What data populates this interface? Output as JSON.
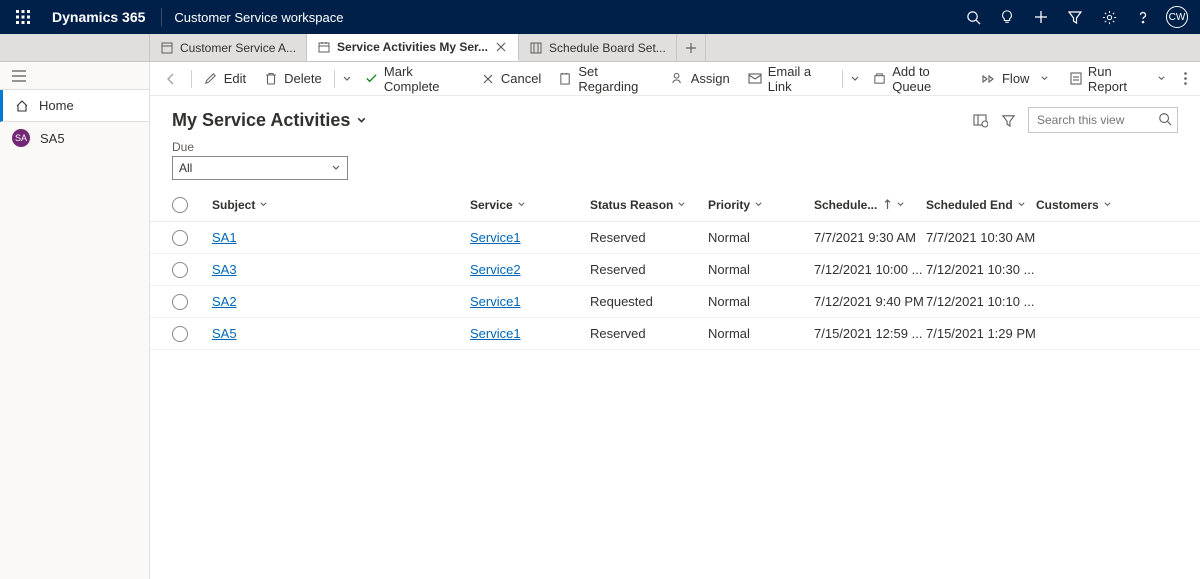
{
  "header": {
    "brand": "Dynamics 365",
    "app_name": "Customer Service workspace",
    "avatar_initials": "CW"
  },
  "tabs": [
    {
      "label": "Customer Service A..."
    },
    {
      "label": "Service Activities My Ser..."
    },
    {
      "label": "Schedule Board Set..."
    }
  ],
  "nav": {
    "home_label": "Home",
    "record_label": "SA5",
    "record_avatar": "SA"
  },
  "commands": {
    "edit": "Edit",
    "delete": "Delete",
    "mark_complete": "Mark Complete",
    "cancel": "Cancel",
    "set_regarding": "Set Regarding",
    "assign": "Assign",
    "email_link": "Email a Link",
    "add_queue": "Add to Queue",
    "flow": "Flow",
    "run_report": "Run Report"
  },
  "view": {
    "title": "My Service Activities",
    "search_placeholder": "Search this view",
    "due_label": "Due",
    "due_value": "All"
  },
  "columns": {
    "subject": "Subject",
    "service": "Service",
    "status": "Status Reason",
    "priority": "Priority",
    "sched_start": "Schedule...",
    "sched_end": "Scheduled End",
    "customers": "Customers"
  },
  "rows": [
    {
      "subject": "SA1",
      "service": "Service1",
      "status": "Reserved",
      "priority": "Normal",
      "start": "7/7/2021 9:30 AM",
      "end": "7/7/2021 10:30 AM",
      "customers": ""
    },
    {
      "subject": "SA3",
      "service": "Service2",
      "status": "Reserved",
      "priority": "Normal",
      "start": "7/12/2021 10:00 ...",
      "end": "7/12/2021 10:30 ...",
      "customers": ""
    },
    {
      "subject": "SA2",
      "service": "Service1",
      "status": "Requested",
      "priority": "Normal",
      "start": "7/12/2021 9:40 PM",
      "end": "7/12/2021 10:10 ...",
      "customers": ""
    },
    {
      "subject": "SA5",
      "service": "Service1",
      "status": "Reserved",
      "priority": "Normal",
      "start": "7/15/2021 12:59 ...",
      "end": "7/15/2021 1:29 PM",
      "customers": ""
    }
  ]
}
